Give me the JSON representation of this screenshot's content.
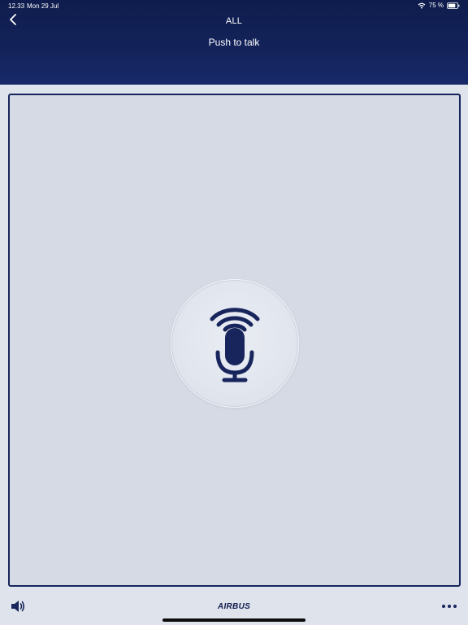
{
  "status_bar": {
    "time": "12.33",
    "date": "Mon 29 Jul",
    "battery": "75 %",
    "icons": [
      "wifi-icon",
      "battery-icon"
    ]
  },
  "header": {
    "title": "ALL",
    "subtitle": "Push to talk",
    "back_icon": "chevron-left-icon"
  },
  "main": {
    "ptt_icon": "microphone-broadcast-icon"
  },
  "footer": {
    "volume_icon": "speaker-icon",
    "brand": "AIRBUS",
    "more_icon": "more-dots-icon"
  },
  "colors": {
    "header_bg": "#13235a",
    "accent": "#17255c",
    "panel_bg": "#d5dae4",
    "page_bg": "#dfe3ec"
  }
}
